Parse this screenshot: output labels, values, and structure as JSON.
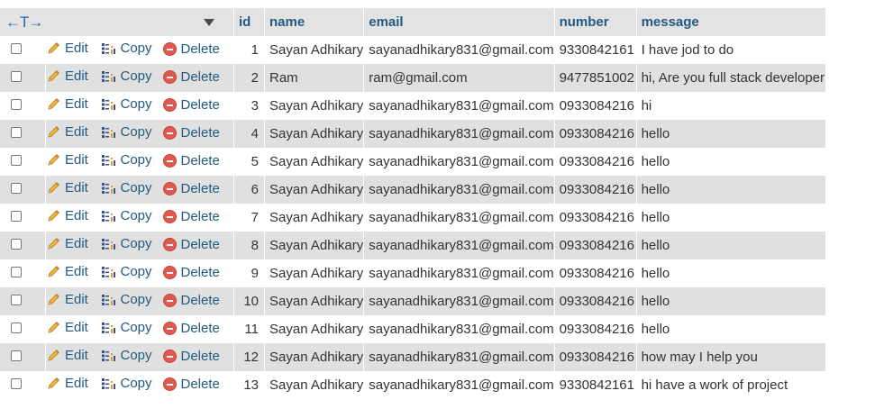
{
  "header": {
    "lr_glyph": "←T→",
    "columns": [
      {
        "key": "id",
        "label": "id"
      },
      {
        "key": "name",
        "label": "name"
      },
      {
        "key": "email",
        "label": "email"
      },
      {
        "key": "number",
        "label": "number"
      },
      {
        "key": "message",
        "label": "message"
      }
    ]
  },
  "actions": {
    "edit_label": "Edit",
    "copy_label": "Copy",
    "delete_label": "Delete"
  },
  "colors": {
    "link": "#235a81",
    "row_alt": "#e0e0e0",
    "header_bg": "#e3e3e3",
    "delete_icon": "#e05a4f"
  },
  "rows": [
    {
      "id": "1",
      "name": "Sayan Adhikary",
      "email": "sayanadhikary831@gmail.com",
      "number": "9330842161",
      "message": "I have jod to do"
    },
    {
      "id": "2",
      "name": "Ram",
      "email": "ram@gmail.com",
      "number": "9477851002",
      "message": "hi, Are you full stack developer"
    },
    {
      "id": "3",
      "name": "Sayan Adhikary",
      "email": "sayanadhikary831@gmail.com",
      "number": "0933084216",
      "message": "hi"
    },
    {
      "id": "4",
      "name": "Sayan Adhikary",
      "email": "sayanadhikary831@gmail.com",
      "number": "0933084216",
      "message": "hello"
    },
    {
      "id": "5",
      "name": "Sayan Adhikary",
      "email": "sayanadhikary831@gmail.com",
      "number": "0933084216",
      "message": "hello"
    },
    {
      "id": "6",
      "name": "Sayan Adhikary",
      "email": "sayanadhikary831@gmail.com",
      "number": "0933084216",
      "message": "hello"
    },
    {
      "id": "7",
      "name": "Sayan Adhikary",
      "email": "sayanadhikary831@gmail.com",
      "number": "0933084216",
      "message": "hello"
    },
    {
      "id": "8",
      "name": "Sayan Adhikary",
      "email": "sayanadhikary831@gmail.com",
      "number": "0933084216",
      "message": "hello"
    },
    {
      "id": "9",
      "name": "Sayan Adhikary",
      "email": "sayanadhikary831@gmail.com",
      "number": "0933084216",
      "message": "hello"
    },
    {
      "id": "10",
      "name": "Sayan Adhikary",
      "email": "sayanadhikary831@gmail.com",
      "number": "0933084216",
      "message": "hello"
    },
    {
      "id": "11",
      "name": "Sayan Adhikary",
      "email": "sayanadhikary831@gmail.com",
      "number": "0933084216",
      "message": "hello"
    },
    {
      "id": "12",
      "name": "Sayan Adhikary",
      "email": "sayanadhikary831@gmail.com",
      "number": "0933084216",
      "message": "how may I help you"
    },
    {
      "id": "13",
      "name": "Sayan Adhikary",
      "email": "sayanadhikary831@gmail.com",
      "number": "9330842161",
      "message": "hi have a work of project"
    }
  ]
}
